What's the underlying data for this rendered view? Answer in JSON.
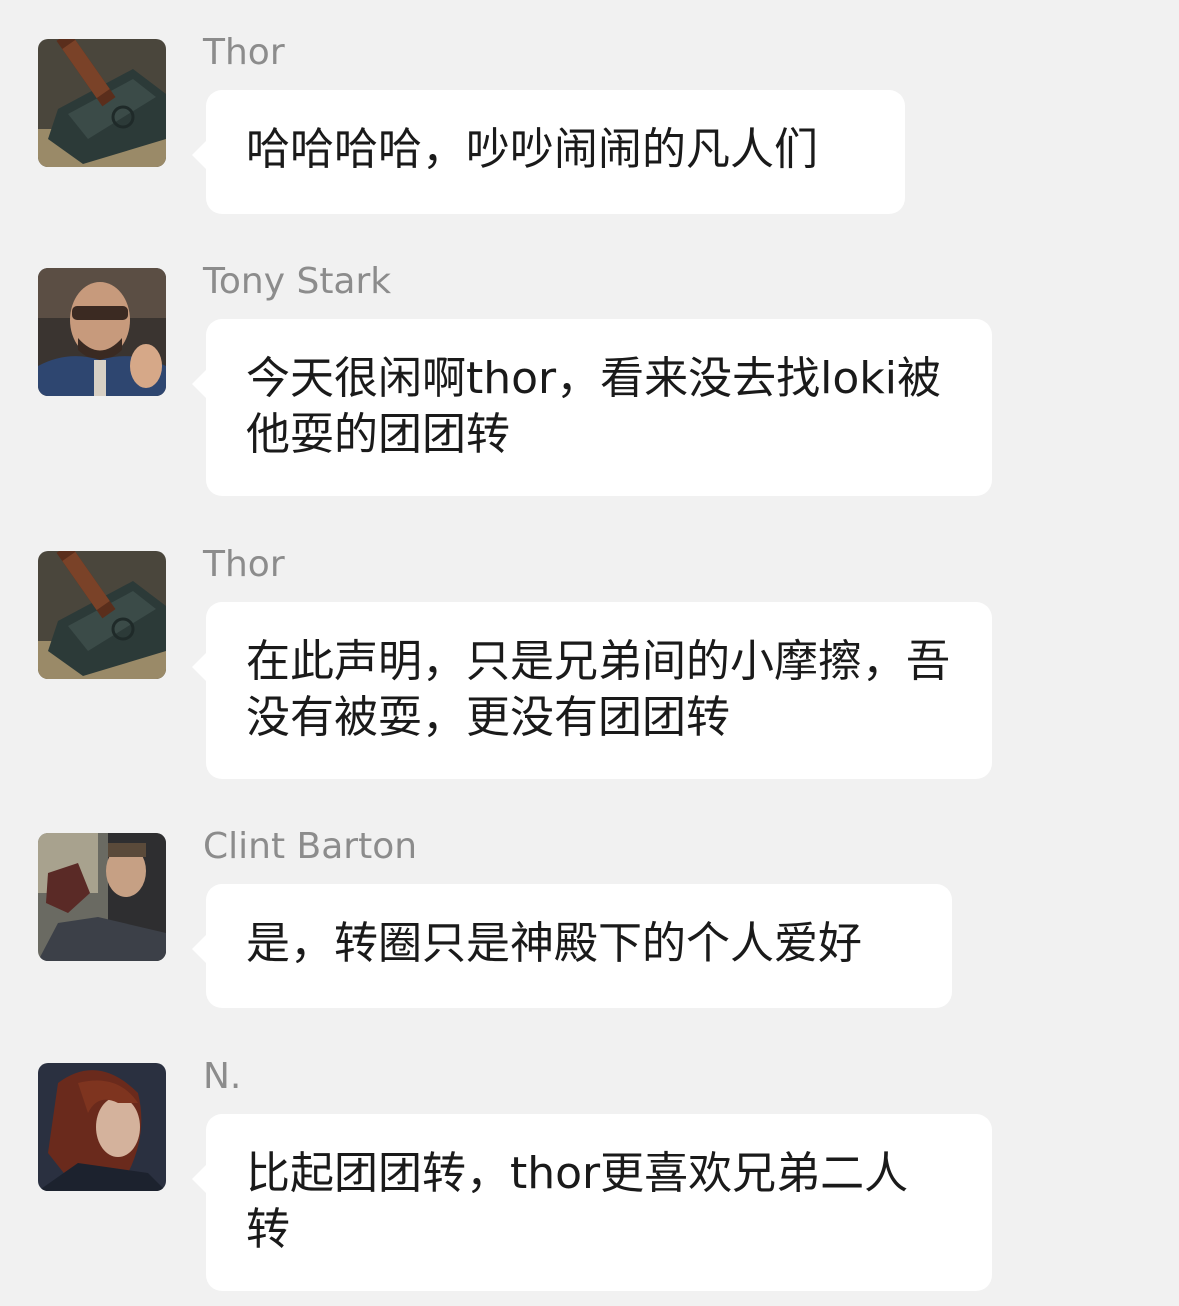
{
  "conversation": {
    "messages": [
      {
        "sender": "Thor",
        "avatar_icon": "hammer-avatar-icon",
        "text": "哈哈哈哈，吵吵闹闹的凡人们"
      },
      {
        "sender": "Tony Stark",
        "avatar_icon": "tony-avatar-icon",
        "text": "今天很闲啊thor，看来没去找loki被他耍的团团转"
      },
      {
        "sender": "Thor",
        "avatar_icon": "hammer-avatar-icon",
        "text": "在此声明，只是兄弟间的小摩擦，吾没有被耍，更没有团团转"
      },
      {
        "sender": "Clint Barton",
        "avatar_icon": "clint-avatar-icon",
        "text": "是，转圈只是神殿下的个人爱好"
      },
      {
        "sender": "N.",
        "avatar_icon": "natasha-avatar-icon",
        "text": "比起团团转，thor更喜欢兄弟二人转"
      }
    ]
  },
  "colors": {
    "background": "#f1f1f1",
    "bubble": "#ffffff",
    "sender_name": "#8c8c8c",
    "message_text": "#1a1a1a"
  }
}
